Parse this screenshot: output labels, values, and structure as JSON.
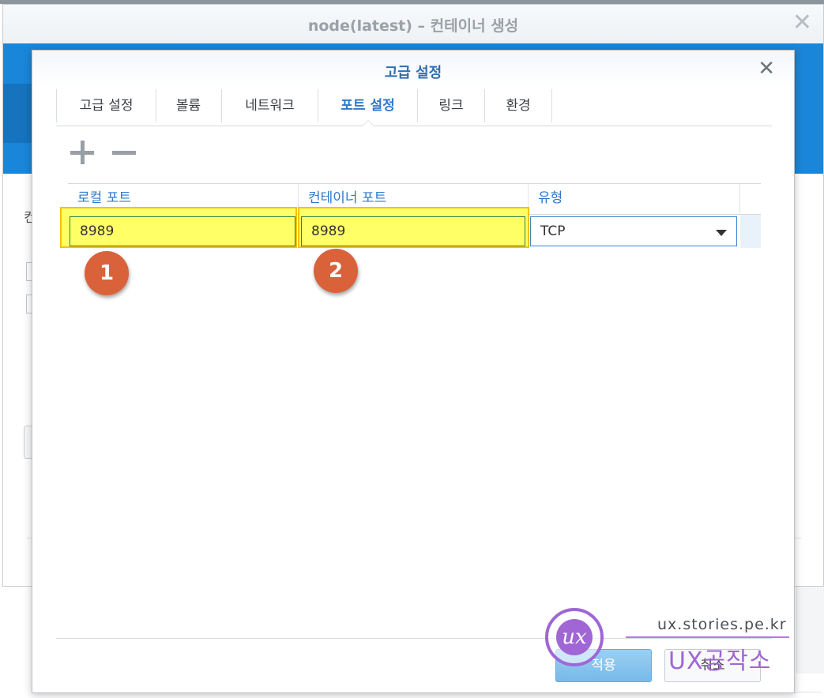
{
  "background_window": {
    "title": "node(latest) – 컨테이너 생성",
    "close_icon": "close-icon",
    "partial_label": "컨"
  },
  "dialog": {
    "title": "고급 설정",
    "close_icon": "close-icon",
    "tabs": [
      {
        "label": "고급 설정",
        "active": false
      },
      {
        "label": "볼륨",
        "active": false
      },
      {
        "label": "네트워크",
        "active": false
      },
      {
        "label": "포트 설정",
        "active": true
      },
      {
        "label": "링크",
        "active": false
      },
      {
        "label": "환경",
        "active": false
      }
    ],
    "toolbar": {
      "add_icon": "plus-icon",
      "remove_icon": "minus-icon"
    },
    "grid": {
      "columns": [
        "로컬 포트",
        "컨테이너 포트",
        "유형"
      ],
      "rows": [
        {
          "local_port": "8989",
          "container_port": "8989",
          "type": "TCP"
        }
      ]
    },
    "annotations": {
      "step1": "1",
      "step2": "2",
      "highlight_color": "#ffff66",
      "badge_color": "#d9623a"
    },
    "footer": {
      "apply_label": "적용",
      "cancel_label": "취소"
    }
  },
  "watermark": {
    "logo_text": "ux",
    "url": "ux.stories.pe.kr",
    "brand": "UX공작소"
  },
  "colors": {
    "accent": "#2f78c9",
    "banner": "#1a86d9"
  }
}
